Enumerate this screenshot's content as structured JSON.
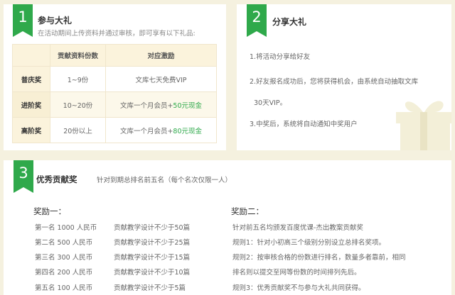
{
  "section1": {
    "number": "1",
    "title": "参与大礼",
    "subtitle": "在活动期间上传资料并通过审核，即可享有以下礼品:",
    "headers": [
      "",
      "贡献资料份数",
      "对应激励"
    ],
    "rows": [
      {
        "name": "普庆奖",
        "count": "1~9份",
        "reward": "文库七天免费VIP",
        "bonus": ""
      },
      {
        "name": "进阶奖",
        "count": "10~20份",
        "reward": "文库一个月会员+",
        "bonus": "50元现金"
      },
      {
        "name": "高阶奖",
        "count": "20份以上",
        "reward": "文库一个月会员+",
        "bonus": "80元现金"
      }
    ]
  },
  "section2": {
    "number": "2",
    "title": "分享大礼",
    "items": [
      "1.将活动分享给好友",
      "2.好友报名成功后，您将获得机会，由系统自动抽取文库",
      "30天VIP。",
      "3.中奖后，系统将自动通知中奖用户"
    ]
  },
  "section3": {
    "number": "3",
    "title": "优秀贡献奖",
    "subtitle": "针对到期总排名前五名（每个名次仅限一人）",
    "col1": {
      "header": "奖励一：",
      "rows": [
        {
          "rank": "第一名 1000 人民币",
          "req": "贡献教学设计不少于50篇"
        },
        {
          "rank": "第二名 500 人民币",
          "req": "贡献教学设计不少于25篇"
        },
        {
          "rank": "第三名 300 人民币",
          "req": "贡献教学设计不少于15篇"
        },
        {
          "rank": "第四名 200 人民币",
          "req": "贡献教学设计不少于10篇"
        },
        {
          "rank": "第五名 100 人民币",
          "req": "贡献教学设计不少于5篇"
        }
      ]
    },
    "col2": {
      "header": "奖励二：",
      "highlight": "针对前五名均颁发百度优课-杰出教案贡献奖",
      "rules": [
        "规则1：针对小初高三个级别分别设立总排名奖项。",
        "规则2：按审核合格的份数进行排名，数量多者靠前，相同",
        "排名则以提交至网等份数的时间排列先后。",
        "规则3：优秀贡献奖不与参与大礼共同获得。"
      ]
    }
  },
  "colors": {
    "accent": "#2fa94b",
    "background": "#f5f1df"
  }
}
